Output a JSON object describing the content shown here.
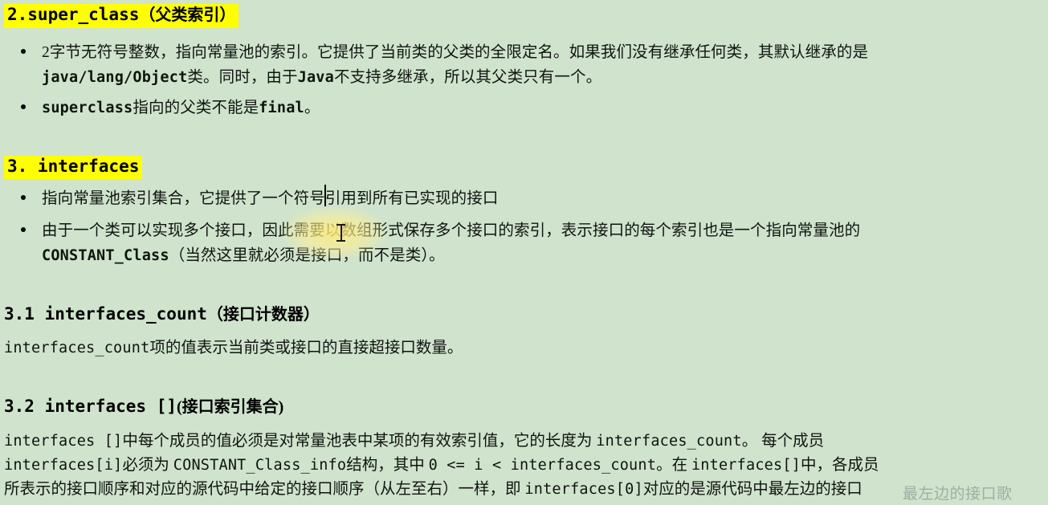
{
  "page": {
    "background_color": "#cfe3cd",
    "highlight_color": "#ffff00",
    "text_color": "#101410"
  },
  "sections": {
    "super_class": {
      "heading_code": "2.super_class",
      "heading_cjk": "（父类索引）",
      "bullets": [
        {
          "line1_a": "2字节无符号整数，指向常量池的索引。它提供了当前类的父类的全限定名。如果我们没有继承任何类，其默认继承的是",
          "line2_code": "java/lang/Object",
          "line2_b": "类。同时，由于",
          "line2_code2": "Java",
          "line2_c": "不支持多继承，所以其父类只有一个。"
        },
        {
          "code": "superclass",
          "mid": "指向的父类不能是",
          "code2": "final",
          "tail": "。"
        }
      ]
    },
    "interfaces": {
      "heading_code": "3. interfaces",
      "bullets": [
        {
          "text_before_caret": "指向常量池索引集合，它提供了一",
          "text_after_caret": "个符号引用到所有已实现的接口"
        },
        {
          "line1": "由于一个类可以实现多个接口，因此需要以数组形式保存多个接口的索引，表示接口的每个索引也是一个指向常量池的",
          "line2_code": "CONSTANT_Class",
          "line2_tail": "（当然这里就必须是接口，而不是类）。"
        }
      ]
    },
    "interfaces_count": {
      "heading_num": "3.1",
      "heading_code": "interfaces_count",
      "heading_cjk": "（接口计数器）",
      "body_code": "interfaces_count",
      "body_cjk": "项的值表示当前类或接口的直接超接口数量。"
    },
    "interfaces_array": {
      "heading_num": "3.2",
      "heading_code": "interfaces",
      "heading_bracket": "[]",
      "heading_cjk": "(接口索引集合)",
      "body": {
        "l1_code": "interfaces []",
        "l1_cjk": "中每个成员的值必须是对常量池表中某项的有效索引值，它的长度为 ",
        "l1_code2": "interfaces_count",
        "l1_tail": "。  每个成员",
        "l2_code": "interfaces[i]",
        "l2_cjk": "必须为 ",
        "l2_code2": "CONSTANT_Class_info",
        "l2_cjk2": "结构，其中 ",
        "l2_code3": "0 <= i < interfaces_count",
        "l2_cjk3": "。在 ",
        "l2_code4": "interfaces[]",
        "l2_tail": "中，各成员",
        "l3_cjk": "所表示的接口顺序和对应的源代码中给定的接口顺序（从左至右）一样，即 ",
        "l3_code": "interfaces[0]",
        "l3_tail": "对应的是源代码中最左边的接口"
      }
    }
  },
  "overlays": {
    "watermark_text": "最左边的接口歌",
    "caret_label": "text-caret",
    "mouse_cursor_label": "i-beam-pointer"
  }
}
